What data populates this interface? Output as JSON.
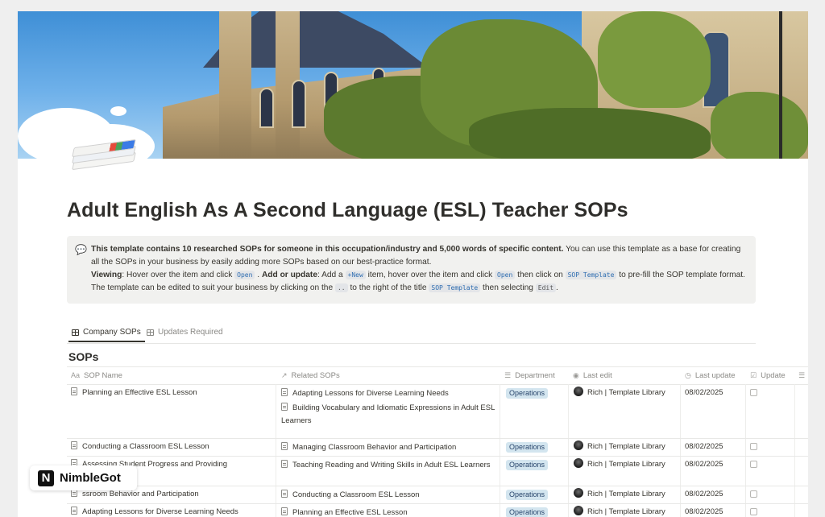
{
  "page": {
    "title": "Adult English As A Second Language (ESL) Teacher SOPs"
  },
  "callout": {
    "icon": "speech-bubble-icon",
    "bold_intro": "This template contains 10 researched SOPs for someone in this occupation/industry and 5,000 words of specific content.",
    "intro_rest": " You can use this template as a base for creating all the SOPs in your business by easily adding more SOPs based on our best-practice format.",
    "viewing_label": "Viewing",
    "viewing_text": ": Hover over the item and click ",
    "open_code": "Open",
    "add_label": "Add or update",
    "add_text": ": Add a ",
    "new_code": "+New",
    "add_text2": " item, hover over the item and click ",
    "open_code2": "Open",
    "add_text3": " then click on ",
    "sop_template_code": "SOP Template",
    "add_text4": " to pre-fill the SOP template format. The template can be edited to suit your business by clicking on the ",
    "dots_code": "..",
    "add_text5": " to the right of the title ",
    "sop_template_code2": "SOP Template",
    "add_text6": " then selecting ",
    "edit_code": "Edit",
    "add_text7": "."
  },
  "tabs": [
    {
      "label": "Company SOPs",
      "active": true
    },
    {
      "label": "Updates Required",
      "active": false
    }
  ],
  "database": {
    "title": "SOPs",
    "columns": {
      "name": {
        "icon_text": "Aa",
        "label": "SOP Name"
      },
      "related": {
        "icon_text": "↗",
        "label": "Related SOPs"
      },
      "department": {
        "icon_text": "☰",
        "label": "Department"
      },
      "last_edit": {
        "icon_text": "◉",
        "label": "Last edit"
      },
      "last_update": {
        "icon_text": "◷",
        "label": "Last update"
      },
      "update": {
        "icon_text": "☑",
        "label": "Update"
      }
    },
    "rows": [
      {
        "name": "Planning an Effective ESL Lesson",
        "related": [
          "Adapting Lessons for Diverse Learning Needs",
          "Building Vocabulary and Idiomatic Expressions in Adult ESL Learners"
        ],
        "department": "Operations",
        "editor": "Rich | Template Library",
        "date": "08/02/2025"
      },
      {
        "name": "Conducting a Classroom ESL Lesson",
        "related": [
          "Managing Classroom Behavior and Participation"
        ],
        "department": "Operations",
        "editor": "Rich | Template Library",
        "date": "08/02/2025"
      },
      {
        "name": "Assessing Student Progress and Providing",
        "related": [
          "Teaching Reading and Writing Skills in Adult ESL Learners"
        ],
        "department": "Operations",
        "editor": "Rich | Template Library",
        "date": "08/02/2025"
      },
      {
        "name": "ssroom Behavior and Participation",
        "related": [
          "Conducting a Classroom ESL Lesson"
        ],
        "department": "Operations",
        "editor": "Rich | Template Library",
        "date": "08/02/2025"
      },
      {
        "name": "Adapting Lessons for Diverse Learning Needs",
        "related": [
          "Planning an Effective ESL Lesson"
        ],
        "department": "Operations",
        "editor": "Rich | Template Library",
        "date": "08/02/2025"
      }
    ]
  },
  "watermark": {
    "logo_letter": "N",
    "text": "NimbleGot"
  },
  "colors": {
    "tag_bg": "#d3e5ef",
    "tag_text": "#28456c",
    "code_text": "#2e6db0",
    "callout_bg": "#f1f1ef"
  }
}
